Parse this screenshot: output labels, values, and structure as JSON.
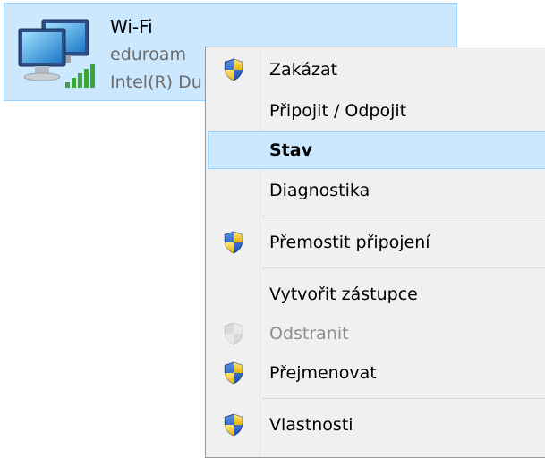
{
  "adapter": {
    "name": "Wi-Fi",
    "network": "eduroam",
    "device": "Intel(R) Du",
    "icon": "network-computers-icon",
    "signal_icon": "wifi-signal-bars-icon"
  },
  "menu": {
    "items": [
      {
        "label": "Zakázat",
        "icon": "uac-shield-icon"
      },
      {
        "label": "Připojit / Odpojit"
      },
      {
        "label": "Stav",
        "default": true,
        "highlighted": true
      },
      {
        "label": "Diagnostika"
      },
      {
        "label": "Přemostit připojení",
        "icon": "uac-shield-icon"
      },
      {
        "label": "Vytvořit zástupce"
      },
      {
        "label": "Odstranit",
        "icon": "uac-shield-icon",
        "disabled": true
      },
      {
        "label": "Přejmenovat",
        "icon": "uac-shield-icon"
      },
      {
        "label": "Vlastnosti",
        "icon": "uac-shield-icon"
      }
    ]
  },
  "colors": {
    "selection_fill": "#cce8ff",
    "selection_border": "#99d1ff",
    "menu_background": "#f0f0f0",
    "signal_green": "#3aa63a"
  }
}
